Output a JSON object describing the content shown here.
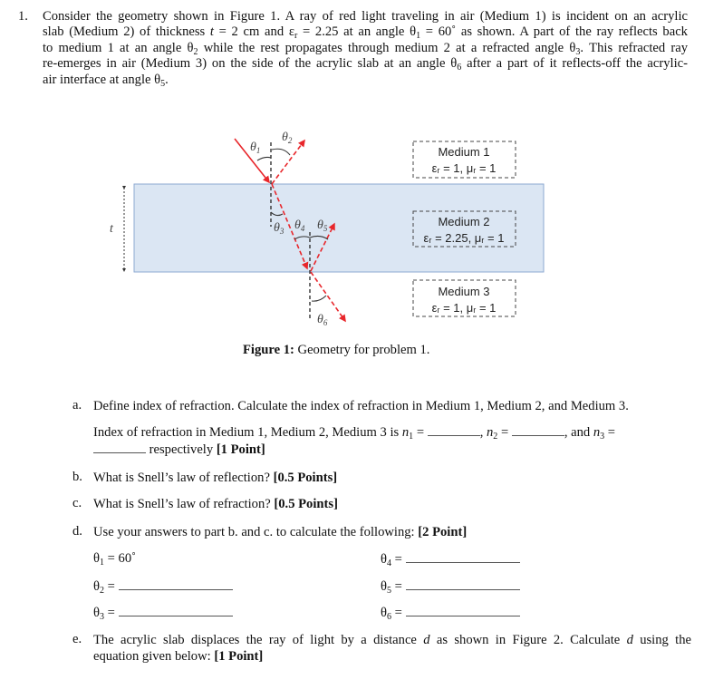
{
  "question": {
    "number": "1.",
    "lines": [
      "Consider the geometry shown in Figure 1. A ray of red light traveling in air (Medium 1) is incident on an acrylic",
      "slab (Medium 2) of thickness {t} = 2 cm and ε{r} = 2.25 at an angle θ{1} = 60˚ as shown. A part of the ray reflects back",
      "to medium 1 at an angle θ{2} while the rest propagates through medium 2 at a refracted angle θ{3}. This refracted ray",
      "re-emerges in air (Medium 3) on the side of the acrylic slab at an angle θ{6} after a part of it reflects-off the acrylic-",
      "air interface at angle θ{5}."
    ],
    "line1": "Consider the geometry shown in Figure 1. A ray of red light traveling in air (Medium 1) is incident on an acrylic",
    "line2_a": "slab (Medium 2) of thickness ",
    "line2_t": "t",
    "line2_b": " = 2 cm and ε",
    "line2_r": "r",
    "line2_c": " = 2.25 at an angle θ",
    "line2_1": "1",
    "line2_d": " = 60˚ as shown. A part of the ray reflects back",
    "line3_a": "to medium 1 at an angle θ",
    "line3_2": "2",
    "line3_b": " while the rest propagates through medium 2 at a refracted angle θ",
    "line3_3": "3",
    "line3_c": ". This refracted ray",
    "line4_a": "re-emerges in air (Medium 3) on the side of the acrylic slab at an angle θ",
    "line4_6": "6",
    "line4_b": " after a part of it reflects-off the acrylic-",
    "line5_a": "air interface at angle θ",
    "line5_5": "5",
    "line5_b": "."
  },
  "figure": {
    "thickness_label": "t",
    "angles": {
      "theta1": {
        "sym": "θ",
        "sub": "1"
      },
      "theta2": {
        "sym": "θ",
        "sub": "2"
      },
      "theta3": {
        "sym": "θ",
        "sub": "3"
      },
      "theta4": {
        "sym": "θ",
        "sub": "4"
      },
      "theta5": {
        "sym": "θ",
        "sub": "5"
      },
      "theta6": {
        "sym": "θ",
        "sub": "6"
      }
    },
    "media": [
      {
        "name": "Medium 1",
        "props": "εᵣ = 1, μᵣ = 1"
      },
      {
        "name": "Medium 2",
        "props": "εᵣ = 2.25, μᵣ = 1"
      },
      {
        "name": "Medium 3",
        "props": "εᵣ = 1, μᵣ = 1"
      }
    ],
    "colors": {
      "slab_fill": "#dbe6f3",
      "slab_stroke": "#8eaad2",
      "ray": "#e8262b",
      "normal": "#333333"
    },
    "caption_bold": "Figure 1:",
    "caption_text": " Geometry for problem 1."
  },
  "parts": {
    "a": {
      "letter": "a.",
      "text": "Define index of refraction. Calculate the index of refraction in Medium 1, Medium 2, and Medium 3.",
      "answer_a": "Index of refraction in Medium 1, Medium 2, Medium 3 is ",
      "n1": "n",
      "n1_sub": "1",
      "eq": " = ",
      "comma1": ", ",
      "n2": "n",
      "n2_sub": "2",
      "comma2": ", and ",
      "n3": "n",
      "n3_sub": "3",
      "respectively": " respectively ",
      "points": "[1 Point]"
    },
    "b": {
      "letter": "b.",
      "text": "What is Snell’s law of reflection? ",
      "points": "[0.5 Points]"
    },
    "c": {
      "letter": "c.",
      "text": "What is Snell’s law of refraction? ",
      "points": "[0.5 Points]"
    },
    "d": {
      "letter": "d.",
      "text": "Use your answers to part b. and c. to calculate the following: ",
      "points": "[2 Point]",
      "equations": [
        {
          "sym": "θ",
          "sub": "1",
          "eq": " = ",
          "value": "60˚"
        },
        {
          "sym": "θ",
          "sub": "2",
          "eq": " = ",
          "value": ""
        },
        {
          "sym": "θ",
          "sub": "3",
          "eq": " = ",
          "value": ""
        },
        {
          "sym": "θ",
          "sub": "4",
          "eq": " = ",
          "value": ""
        },
        {
          "sym": "θ",
          "sub": "5",
          "eq": " = ",
          "value": ""
        },
        {
          "sym": "θ",
          "sub": "6",
          "eq": " = ",
          "value": ""
        }
      ]
    },
    "e": {
      "letter": "e.",
      "text_a": "The acrylic slab displaces the ray of light by a distance ",
      "d1": "d",
      "text_b": " as shown in Figure 2. Calculate ",
      "d2": "d",
      "text_c": " using the",
      "text_d": "equation given below: ",
      "points": "[1 Point]"
    }
  }
}
